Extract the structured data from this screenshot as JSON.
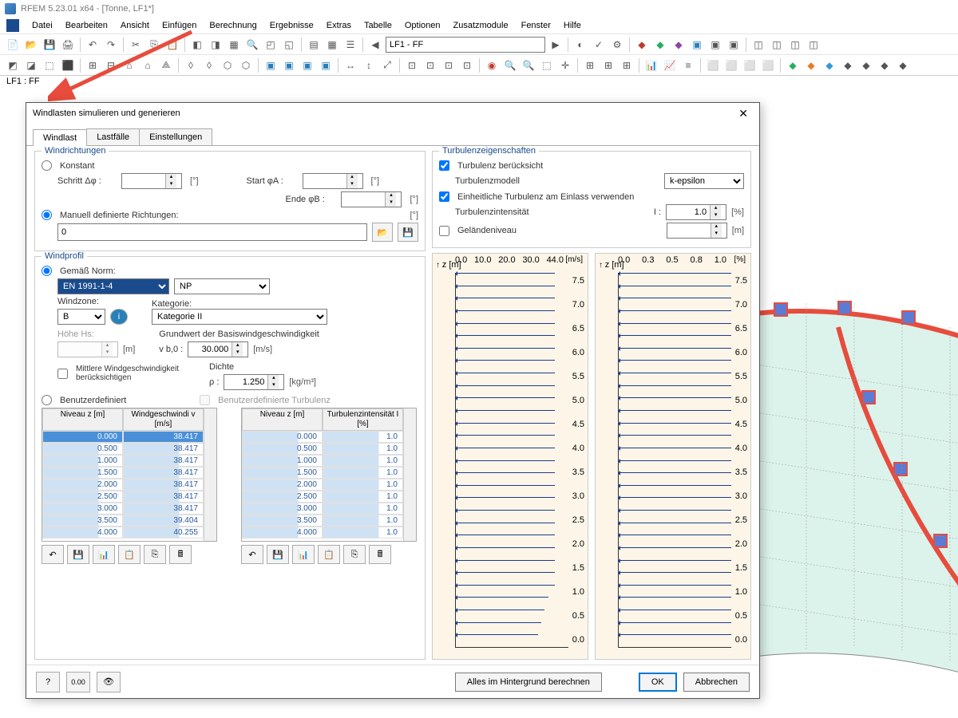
{
  "title": "RFEM 5.23.01 x64 - [Tonne, LF1*]",
  "menu": [
    "Datei",
    "Bearbeiten",
    "Ansicht",
    "Einfügen",
    "Berechnung",
    "Ergebnisse",
    "Extras",
    "Tabelle",
    "Optionen",
    "Zusatzmodule",
    "Fenster",
    "Hilfe"
  ],
  "loadcase_dropdown": "LF1 - FF",
  "statusline": "LF1 : FF",
  "dialog": {
    "title": "Windlasten simulieren und generieren",
    "tabs": [
      "Windlast",
      "Lastfälle",
      "Einstellungen"
    ],
    "active_tab": 0,
    "windrichtungen": {
      "legend": "Windrichtungen",
      "konstant": "Konstant",
      "schritt": "Schritt Δφ :",
      "start": "Start φA :",
      "ende": "Ende φB :",
      "manuell": "Manuell definierte Richtungen:",
      "manuell_value": "0",
      "unit": "[°]"
    },
    "windprofil": {
      "legend": "Windprofil",
      "norm": "Gemäß Norm:",
      "norm_value": "EN 1991-1-4",
      "anhang": "NP",
      "windzone_label": "Windzone:",
      "windzone": "B",
      "kategorie_label": "Kategorie:",
      "kategorie": "Kategorie II",
      "hoehe": "Höhe Hs:",
      "hoehe_unit": "[m]",
      "grundwert": "Grundwert der Basiswindgeschwindigkeit",
      "vb0_label": "v b,0 :",
      "vb0": "30.000",
      "vb0_unit": "[m/s]",
      "mittlere": "Mittlere Windgeschwindigkeit berücksichtigen",
      "dichte_label": "Dichte",
      "rho_label": "ρ :",
      "rho": "1.250",
      "rho_unit": "[kg/m³]",
      "benutzer": "Benutzerdefiniert",
      "benutzer_turb": "Benutzerdefinierte Turbulenz",
      "tbl1_headers": [
        "Niveau\nz [m]",
        "Windgeschwindi\nv [m/s]"
      ],
      "tbl2_headers": [
        "Niveau\nz [m]",
        "Turbulenzintensität\nI [%]"
      ],
      "tbl1_rows": [
        [
          "0.000",
          "38.417"
        ],
        [
          "0.500",
          "38.417"
        ],
        [
          "1.000",
          "38.417"
        ],
        [
          "1.500",
          "38.417"
        ],
        [
          "2.000",
          "38.417"
        ],
        [
          "2.500",
          "38.417"
        ],
        [
          "3.000",
          "38.417"
        ],
        [
          "3.500",
          "39.404"
        ],
        [
          "4.000",
          "40.255"
        ]
      ],
      "tbl2_rows": [
        [
          "0.000",
          "1.0"
        ],
        [
          "0.500",
          "1.0"
        ],
        [
          "1.000",
          "1.0"
        ],
        [
          "1.500",
          "1.0"
        ],
        [
          "2.000",
          "1.0"
        ],
        [
          "2.500",
          "1.0"
        ],
        [
          "3.000",
          "1.0"
        ],
        [
          "3.500",
          "1.0"
        ],
        [
          "4.000",
          "1.0"
        ]
      ]
    },
    "turbulenz": {
      "legend": "Turbulenzeigenschaften",
      "check1": "Turbulenz berücksicht",
      "modell_label": "Turbulenzmodell",
      "modell": "k-epsilon",
      "check2": "Einheitliche Turbulenz am Einlass verwenden",
      "intensitaet_label": "Turbulenzintensität",
      "intensitaet_sym": "I :",
      "intensitaet": "1.0",
      "intensitaet_unit": "[%]",
      "gelaende": "Geländeniveau",
      "gelaende_unit": "[m]"
    },
    "graphs": {
      "g1_ticks": [
        "0.0",
        "10.0",
        "20.0",
        "30.0",
        "44.0"
      ],
      "g1_unit": "[m/s]",
      "g2_ticks": [
        "0.0",
        "0.3",
        "0.5",
        "0.8",
        "1.0"
      ],
      "g2_unit": "[%]",
      "y_label": "z [m]",
      "y_ticks": [
        "7.5",
        "7.0",
        "6.5",
        "6.0",
        "5.5",
        "5.0",
        "4.5",
        "4.0",
        "3.5",
        "3.0",
        "2.5",
        "2.0",
        "1.5",
        "1.0",
        "0.5",
        "0.0"
      ]
    },
    "footer": {
      "calc": "Alles im Hintergrund berechnen",
      "ok": "OK",
      "cancel": "Abbrechen"
    }
  }
}
